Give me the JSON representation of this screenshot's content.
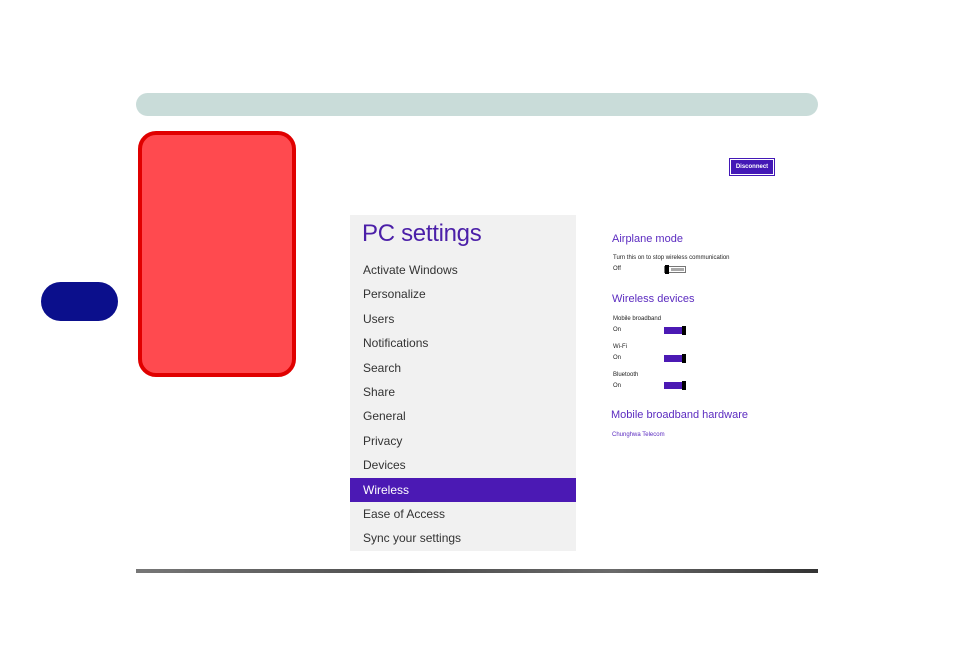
{
  "header": {
    "disconnect_label": "Disconnect"
  },
  "settings": {
    "title": "PC settings",
    "items": [
      {
        "label": "Activate Windows"
      },
      {
        "label": "Personalize"
      },
      {
        "label": "Users"
      },
      {
        "label": "Notifications"
      },
      {
        "label": "Search"
      },
      {
        "label": "Share"
      },
      {
        "label": "General"
      },
      {
        "label": "Privacy"
      },
      {
        "label": "Devices"
      },
      {
        "label": "Wireless"
      },
      {
        "label": "Ease of Access"
      },
      {
        "label": "Sync your settings"
      }
    ],
    "selected": "Wireless"
  },
  "wireless": {
    "airplane": {
      "heading": "Airplane mode",
      "description": "Turn this on to stop wireless communication",
      "state": "Off"
    },
    "devices": {
      "heading": "Wireless devices",
      "mobile_broadband": {
        "label": "Mobile broadband",
        "state": "On"
      },
      "wifi": {
        "label": "Wi-Fi",
        "state": "On"
      },
      "bluetooth": {
        "label": "Bluetooth",
        "state": "On"
      }
    },
    "hardware": {
      "heading": "Mobile broadband hardware",
      "provider": "Chunghwa Telecom"
    }
  },
  "colors": {
    "accent": "#4b19b4",
    "top_bar": "#c9dcd9",
    "side_tab": "#0b0f8c",
    "red_box": "#ff4a4f",
    "red_box_border": "#e00000"
  }
}
